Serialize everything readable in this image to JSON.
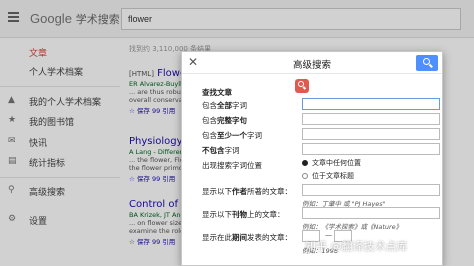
{
  "header": {
    "logo_google": "Google",
    "logo_suffix": "学术搜索",
    "search_value": "flower"
  },
  "sidebar": {
    "items": [
      {
        "label": "文章",
        "icon": "none",
        "active": true
      },
      {
        "label": "个人学术档案",
        "icon": "none",
        "active": false
      },
      {
        "label": "我的个人学术档案",
        "icon": "scholar-cap-icon",
        "active": false
      },
      {
        "label": "我的图书馆",
        "icon": "star-icon",
        "active": false
      },
      {
        "label": "快讯",
        "icon": "mail-icon",
        "active": false
      },
      {
        "label": "统计指标",
        "icon": "bar-chart-icon",
        "active": false
      },
      {
        "label": "高级搜索",
        "icon": "advanced-search-icon",
        "active": false
      },
      {
        "label": "设置",
        "icon": "gear-icon",
        "active": false
      }
    ]
  },
  "results": {
    "info": "找到约 3,110,000 条结果",
    "items": [
      {
        "tag": "[HTML]",
        "title": "Flower",
        "authors": "ER Alvarez-Buylla",
        "snip1": "... are thus robust",
        "snip2": "overall conservation",
        "actions": "☆ 保存 99 引用"
      },
      {
        "tag": "",
        "title": "Physiology of",
        "authors": "A Lang - Differentiation",
        "snip1": "... the flower, Flo",
        "snip2": "the flower primordia",
        "actions": "☆ 保存 99 引用"
      },
      {
        "tag": "",
        "title": "Control of flower",
        "authors": "BA Krizek, JT Anderson",
        "snip1": "... on flower size a",
        "snip2": "examine the role o",
        "actions": "☆ 保存 99 引用"
      }
    ]
  },
  "modal": {
    "title": "高级搜索",
    "find_heading": "查找文章",
    "rows": [
      {
        "pre": "包含",
        "bold": "全部",
        "post": "字词"
      },
      {
        "pre": "包含",
        "bold": "完整字句",
        "post": ""
      },
      {
        "pre": "包含",
        "bold": "至少一个",
        "post": "字词"
      },
      {
        "pre": "",
        "bold": "不包含",
        "post": "字词"
      }
    ],
    "location_label": "出现搜索字词位置",
    "location_options": [
      "文章中任何位置",
      "位于文章标题"
    ],
    "location_selected": 0,
    "author_label": {
      "pre": "显示以下",
      "bold": "作者",
      "post": "所著的文章："
    },
    "author_example": "例如：丁肇中 或 \"PJ Hayes\"",
    "publication_label": {
      "pre": "显示以下",
      "bold": "刊物",
      "post": "上的文章："
    },
    "publication_example": "例如：《学术探索》或《Nature》",
    "date_label": {
      "pre": "显示在此",
      "bold": "期间",
      "post": "发表的文章："
    },
    "date_separator": "—",
    "date_example": "例如：1996"
  },
  "watermark": "知乎 @翻译技术点库",
  "colors": {
    "accent_blue": "#4d90fe",
    "active_red": "#d14836",
    "link_blue": "#1a0dab",
    "green_authors": "#006621"
  }
}
